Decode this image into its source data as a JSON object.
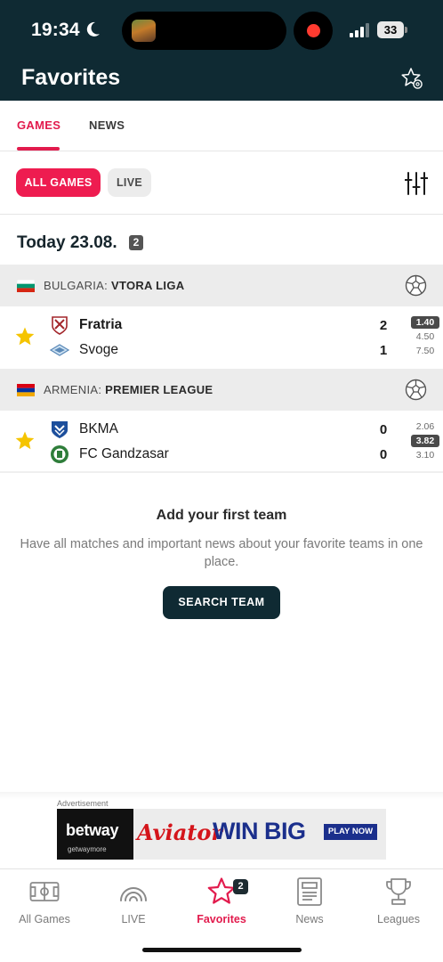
{
  "status_bar": {
    "time": "19:34",
    "battery": "33"
  },
  "header": {
    "title": "Favorites"
  },
  "tabs": [
    {
      "label": "GAMES",
      "active": true
    },
    {
      "label": "NEWS",
      "active": false
    }
  ],
  "filters": {
    "all_label": "ALL GAMES",
    "live_label": "LIVE"
  },
  "date": {
    "label": "Today 23.08.",
    "count": "2"
  },
  "leagues": [
    {
      "country": "BULGARIA:",
      "league": "VTORA LIGA",
      "flag": "bulgaria",
      "match": {
        "home": {
          "name": "Fratria",
          "score": "2"
        },
        "away": {
          "name": "Svoge",
          "score": "1"
        },
        "odds": [
          "1.40",
          "4.50",
          "7.50"
        ]
      }
    },
    {
      "country": "ARMENIA:",
      "league": "PREMIER LEAGUE",
      "flag": "armenia",
      "match": {
        "home": {
          "name": "BKMA",
          "score": "0"
        },
        "away": {
          "name": "FC Gandzasar",
          "score": "0"
        },
        "odds": [
          "2.06",
          "3.82",
          "3.10"
        ]
      }
    }
  ],
  "empty_state": {
    "title": "Add your first team",
    "text": "Have all matches and important news about your favorite teams in one place.",
    "button": "SEARCH TEAM"
  },
  "ad": {
    "label": "Advertisement",
    "brand": "betway",
    "brand_sub": "getwaymore",
    "game": "Aviator",
    "headline": "WIN BIG",
    "cta": "PLAY NOW"
  },
  "bottom_nav": [
    {
      "label": "All Games",
      "icon": "pitch-icon"
    },
    {
      "label": "LIVE",
      "icon": "live-signal-icon"
    },
    {
      "label": "Favorites",
      "icon": "star-icon",
      "badge": "2",
      "active": true
    },
    {
      "label": "News",
      "icon": "newspaper-icon"
    },
    {
      "label": "Leagues",
      "icon": "trophy-icon"
    }
  ],
  "colors": {
    "accent": "#e21b4d",
    "header_bg": "#0f2a33",
    "favorite_star": "#f5c400"
  }
}
